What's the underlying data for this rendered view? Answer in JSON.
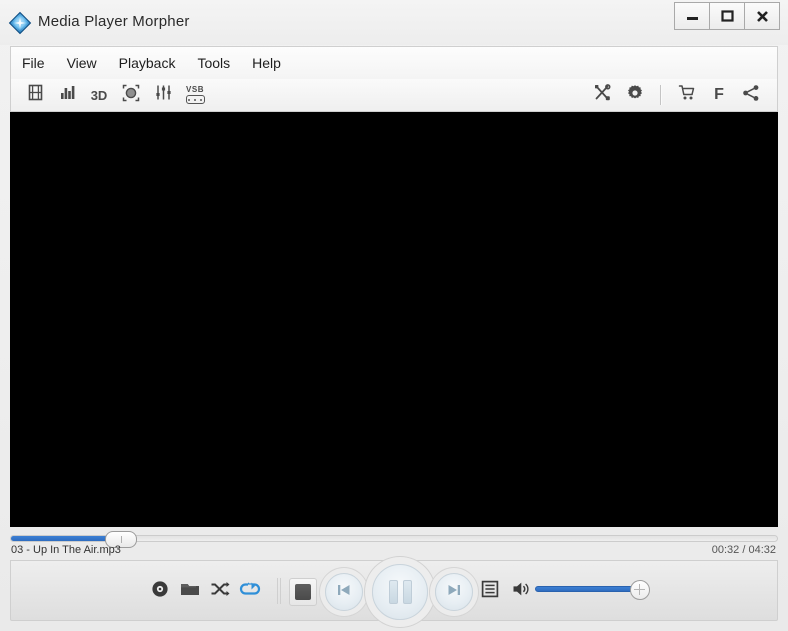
{
  "window": {
    "title": "Media Player Morpher",
    "logo_icon": "diamond-gem-logo",
    "controls": [
      {
        "name": "minimize",
        "icon": "minimize-icon"
      },
      {
        "name": "maximize",
        "icon": "maximize-icon"
      },
      {
        "name": "close",
        "icon": "close-icon"
      }
    ]
  },
  "menubar": {
    "items": [
      {
        "label": "File"
      },
      {
        "label": "View"
      },
      {
        "label": "Playback"
      },
      {
        "label": "Tools"
      },
      {
        "label": "Help"
      }
    ]
  },
  "toolbar": {
    "left": [
      {
        "name": "film-strip-icon",
        "label": ""
      },
      {
        "name": "equalizer-bars-icon",
        "label": ""
      },
      {
        "name": "three-d-icon",
        "label": "3D"
      },
      {
        "name": "record-circle-icon",
        "label": ""
      },
      {
        "name": "mixer-sliders-icon",
        "label": ""
      },
      {
        "name": "vsb-icon",
        "label": "VSB"
      }
    ],
    "right": [
      {
        "name": "tools-icon",
        "label": ""
      },
      {
        "name": "gear-icon",
        "label": ""
      },
      {
        "name": "cart-icon",
        "label": ""
      },
      {
        "name": "facebook-icon",
        "label": "F"
      },
      {
        "name": "share-icon",
        "label": ""
      }
    ]
  },
  "player": {
    "track_title": "03 - Up In The Air.mp3",
    "time_display": "00:32 / 04:32",
    "seek_percent": 12,
    "volume_percent": 100,
    "video_background": "#000000",
    "accent_color": "#3b7fd4",
    "repeat_active_color": "#2f8fd8"
  },
  "transport": {
    "disc_label": "",
    "open_label": "",
    "shuffle_label": "",
    "repeat_label": "",
    "stop_label": "",
    "previous_label": "",
    "pause_label": "",
    "next_label": "",
    "playlist_label": "",
    "volume_label": ""
  }
}
